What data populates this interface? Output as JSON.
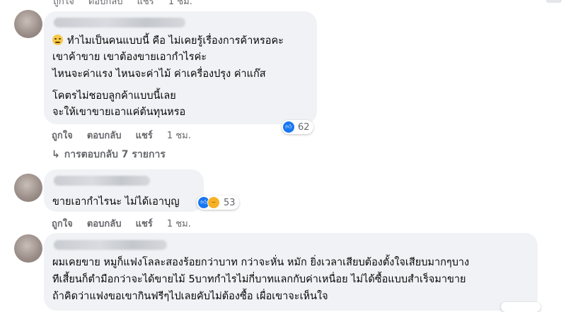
{
  "top_actions": {
    "like": "ถูกใจ",
    "reply": "ตอบกลับ",
    "share": "แชร์",
    "time": "1 ชม."
  },
  "comments": [
    {
      "lines": [
        "ทำไมเป็นคนแบบนี้ คือ ไม่เคยรู้เรื่องการค้าหรอคะ",
        "เขาค้าขาย เขาต้องขายเอากำไรค่ะ",
        "ไหนจะค่าแรง ไหนจะค่าไม้ ค่าเครื่องปรุง ค่าแก๊ส",
        "โคตรไม่ชอบลูกค้าแบบนี้เลย",
        "จะให้เขาขายเอาแค่ต้นทุนหรอ"
      ],
      "reaction_count": "62",
      "actions": {
        "like": "ถูกใจ",
        "reply": "ตอบกลับ",
        "share": "แชร์",
        "time": "1 ชม."
      },
      "replies_link": "การตอบกลับ 7 รายการ"
    },
    {
      "lines": [
        "ขายเอากำไรนะ ไม่ได้เอาบุญ"
      ],
      "reaction_count": "53",
      "actions": {
        "like": "ถูกใจ",
        "reply": "ตอบกลับ",
        "share": "แชร์",
        "time": "1 ชม."
      }
    },
    {
      "lines": [
        "ผมเคยขาย หมูก็แฟงโลละสองร้อยกว่าบาท กว่าจะหั่น หมัก ยิ่งเวลาเสียบต้องตั้งใจเสียบมากๆบาง",
        "ทีเสี้ยนก็ตำมือกว่าจะได้ขายไม้ 5บาทกำไรไม่กี่บาทแลกกับค่าเหนื่อย ไม่ได้ซื้อแบบสำเร็จมาขาย",
        "ถ้าคิดว่าแฟงขอเขากินฟรีๆไปเลยคับไม่ต้องซื้อ เผื่อเขาจะเห็นใจ"
      ]
    }
  ]
}
